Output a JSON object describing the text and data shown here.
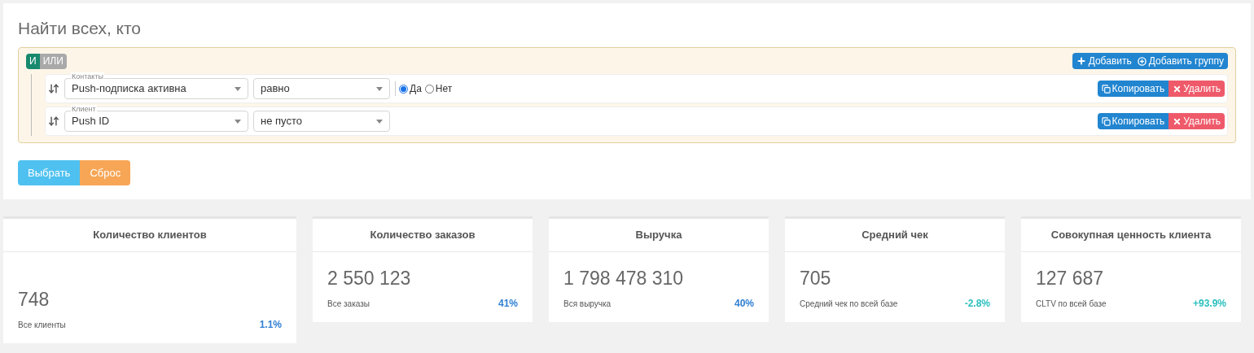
{
  "filter": {
    "title": "Найти всех, кто",
    "logic": [
      {
        "label": "И",
        "selected": true
      },
      {
        "label": "ИЛИ",
        "selected": false
      }
    ],
    "add_button": "Добавить",
    "add_group_button": "Добавить группу",
    "rules": [
      {
        "group": "Контакты",
        "field": "Push-подписка активна",
        "operator": "равно",
        "options": [
          {
            "label": "Да",
            "selected": true
          },
          {
            "label": "Нет",
            "selected": false
          }
        ],
        "copy": "Копировать",
        "delete": "Удалить"
      },
      {
        "group": "Клиент",
        "field": "Push ID",
        "operator": "не пусто",
        "copy": "Копировать",
        "delete": "Удалить"
      }
    ],
    "select_button": "Выбрать",
    "reset_button": "Сброс"
  },
  "stats": [
    {
      "title": "Количество клиентов",
      "value": "748",
      "caption": "Все клиенты",
      "change": "1.1%",
      "color": "#2f7fd3"
    },
    {
      "title": "Количество заказов",
      "value": "2 550 123",
      "caption": "Все заказы",
      "change": "41%",
      "color": "#2f7fd3"
    },
    {
      "title": "Выручка",
      "value": "1 798 478 310",
      "caption": "Вся выручка",
      "change": "40%",
      "color": "#2f7fd3"
    },
    {
      "title": "Средний чек",
      "value": "705",
      "caption": "Средний чек по всей базе",
      "change": "-2.8%",
      "color": "#2bbfbf"
    },
    {
      "title": "Совокупная ценность клиента",
      "value": "127 687",
      "caption": "CLTV по всей базе",
      "change": "+93.9%",
      "color": "#2bbfbf"
    }
  ]
}
